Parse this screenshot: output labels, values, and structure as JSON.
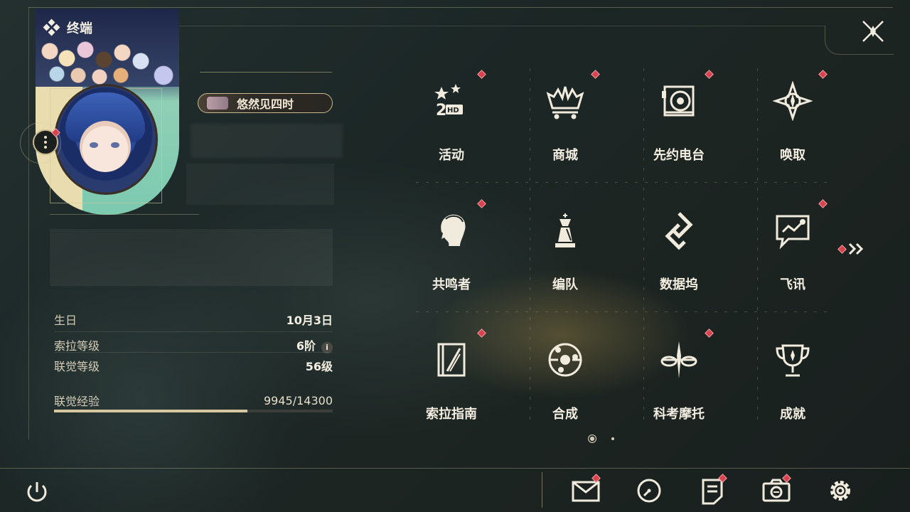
{
  "header": {
    "title": "终端"
  },
  "profile": {
    "name_badge": "悠然见四时"
  },
  "stats": {
    "birthday_label": "生日",
    "birthday_value": "10月3日",
    "sola_level_label": "索拉等级",
    "sola_level_value": "6阶",
    "sola_level_info": "i",
    "union_level_label": "联觉等级",
    "union_level_value": "56级",
    "union_exp_label": "联觉经验",
    "union_exp_value": "9945/14300",
    "union_exp_progress": 0.695
  },
  "grid": {
    "tiles": [
      {
        "label": "活动",
        "icon": "event-icon",
        "badge": true
      },
      {
        "label": "商城",
        "icon": "shop-cart-icon",
        "badge": true
      },
      {
        "label": "先约电台",
        "icon": "radio-icon",
        "badge": true
      },
      {
        "label": "唤取",
        "icon": "summon-compass-icon",
        "badge": true
      },
      {
        "label": "共鸣者",
        "icon": "resonator-profile-icon",
        "badge": true
      },
      {
        "label": "编队",
        "icon": "team-chess-icon",
        "badge": false
      },
      {
        "label": "数据坞",
        "icon": "data-bank-icon",
        "badge": false
      },
      {
        "label": "飞讯",
        "icon": "message-chat-icon",
        "badge": true
      },
      {
        "label": "索拉指南",
        "icon": "guide-book-icon",
        "badge": true
      },
      {
        "label": "合成",
        "icon": "synthesis-icon",
        "badge": false
      },
      {
        "label": "科考摩托",
        "icon": "motorbike-icon",
        "badge": true
      },
      {
        "label": "成就",
        "icon": "trophy-icon",
        "badge": false
      }
    ],
    "page_indicator": {
      "current": 1,
      "total": 2
    }
  },
  "bottom_bar": {
    "buttons": [
      "power-icon",
      "mail-icon",
      "clock-icon",
      "notes-icon",
      "camera-icon",
      "settings-gear-icon"
    ]
  },
  "colors": {
    "accent": "#c9b98d",
    "badge": "#d8434f",
    "text": "#f2ede0"
  }
}
